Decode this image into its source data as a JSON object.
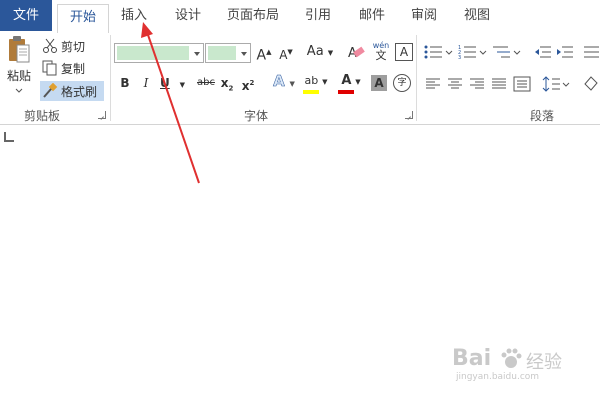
{
  "tabs": {
    "file": "文件",
    "items": [
      "开始",
      "插入",
      "设计",
      "页面布局",
      "引用",
      "邮件",
      "审阅",
      "视图"
    ]
  },
  "clipboard": {
    "paste": "粘贴",
    "cut": "剪切",
    "copy": "复制",
    "format_painter": "格式刷",
    "group_label": "剪贴板"
  },
  "font": {
    "group_label": "字体",
    "grow_label": "A",
    "shrink_label": "A",
    "case_label": "Aa",
    "phonetic_top": "wén",
    "phonetic_bottom": "文",
    "border_char": "A",
    "bold": "B",
    "italic": "I",
    "underline": "U",
    "strike": "abc",
    "subscript": "x",
    "subscript_small": "2",
    "superscript": "x",
    "superscript_small": "2",
    "effects": "A",
    "highlight": "ab",
    "font_color": "A",
    "char_shade": "A",
    "enclose": "字",
    "highlight_color": "#ffff00",
    "font_color_bar": "#e00000"
  },
  "paragraph": {
    "group_label": "段落"
  },
  "watermark": {
    "brand": "Bai",
    "brand2": "经验",
    "url": "jingyan.baidu.com"
  },
  "colors": {
    "file_tab": "#2b579a",
    "active_tab_text": "#2b579a",
    "arrow": "#e03030"
  }
}
